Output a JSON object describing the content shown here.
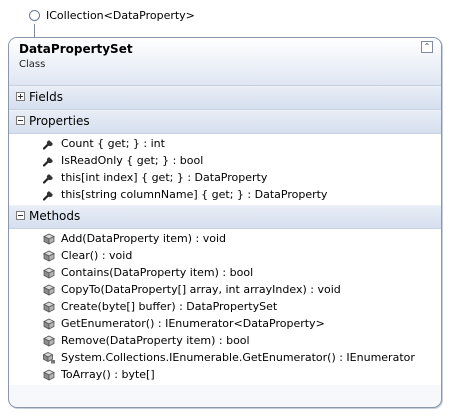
{
  "interface_label": "ICollection<DataProperty>",
  "class": {
    "name": "DataPropertySet",
    "kind": "Class",
    "collapse_glyph": "⌃"
  },
  "sections": {
    "fields": {
      "label": "Fields",
      "state": "collapsed"
    },
    "properties": {
      "label": "Properties",
      "state": "expanded",
      "items": [
        {
          "text": "Count { get; } : int",
          "icon": "wrench-icon"
        },
        {
          "text": "IsReadOnly { get; } : bool",
          "icon": "wrench-icon"
        },
        {
          "text": "this[int index] { get; } : DataProperty",
          "icon": "wrench-icon"
        },
        {
          "text": "this[string columnName] { get; } : DataProperty",
          "icon": "wrench-icon"
        }
      ]
    },
    "methods": {
      "label": "Methods",
      "state": "expanded",
      "items": [
        {
          "text": "Add(DataProperty item) : void",
          "icon": "method-cube-icon"
        },
        {
          "text": "Clear() : void",
          "icon": "method-cube-icon"
        },
        {
          "text": "Contains(DataProperty item) : bool",
          "icon": "method-cube-icon"
        },
        {
          "text": "CopyTo(DataProperty[] array, int arrayIndex) : void",
          "icon": "method-cube-icon"
        },
        {
          "text": "Create(byte[] buffer) : DataPropertySet",
          "icon": "method-cube-icon"
        },
        {
          "text": "GetEnumerator() : IEnumerator<DataProperty>",
          "icon": "method-cube-icon"
        },
        {
          "text": "Remove(DataProperty item) : bool",
          "icon": "method-cube-icon"
        },
        {
          "text": "System.Collections.IEnumerable.GetEnumerator() : IEnumerator",
          "icon": "private-method-cube-icon"
        },
        {
          "text": "ToArray() : byte[]",
          "icon": "method-cube-icon"
        }
      ]
    }
  }
}
